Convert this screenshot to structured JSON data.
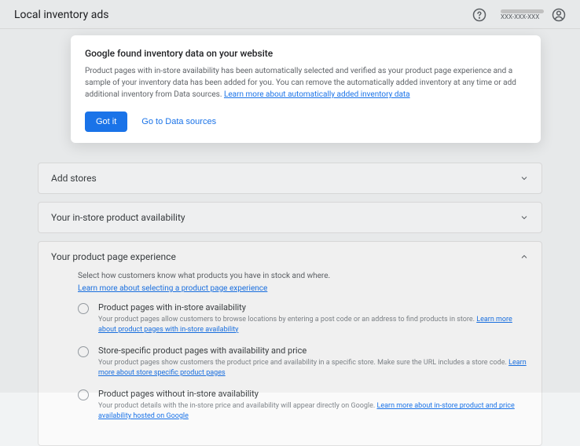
{
  "header": {
    "title": "Local inventory ads",
    "account_id": "XXX-XXX-XXX"
  },
  "tooltip": {
    "title": "Google found inventory data on your website",
    "body_prefix": "Product pages with in-store availability has been automatically selected and verified as your product page experience and a sample of your inventory data has been added for you. You can remove the automatically added inventory at any time or add additional inventory from Data sources. ",
    "learn_more": "Learn more about automatically added inventory data",
    "got_it": "Got it",
    "go_to": "Go to Data sources"
  },
  "panels": {
    "add_stores": {
      "title": "Add stores"
    },
    "availability": {
      "title": "Your in-store product availability"
    },
    "experience": {
      "title": "Your product page experience",
      "desc": "Select how customers know what products you have in stock and where.",
      "learn_more": "Learn more about selecting a product page experience",
      "options": [
        {
          "label": "Product pages with in-store availability",
          "desc_prefix": "Your product pages allow customers to browse locations by entering a post code or an address to find products in store. ",
          "desc_link": "Learn more about product pages with in-store availability"
        },
        {
          "label": "Store-specific product pages with availability and price",
          "desc_prefix": "Your product pages show customers the product price and availability in a specific store. Make sure the URL includes a store code. ",
          "desc_link": "Learn more about store specific product pages"
        },
        {
          "label": "Product pages without in-store availability",
          "desc_prefix": "Your product details with the in-store price and availability will appear directly on Google. ",
          "desc_link": "Learn more about in-store product and price availability hosted on Google"
        }
      ]
    }
  }
}
